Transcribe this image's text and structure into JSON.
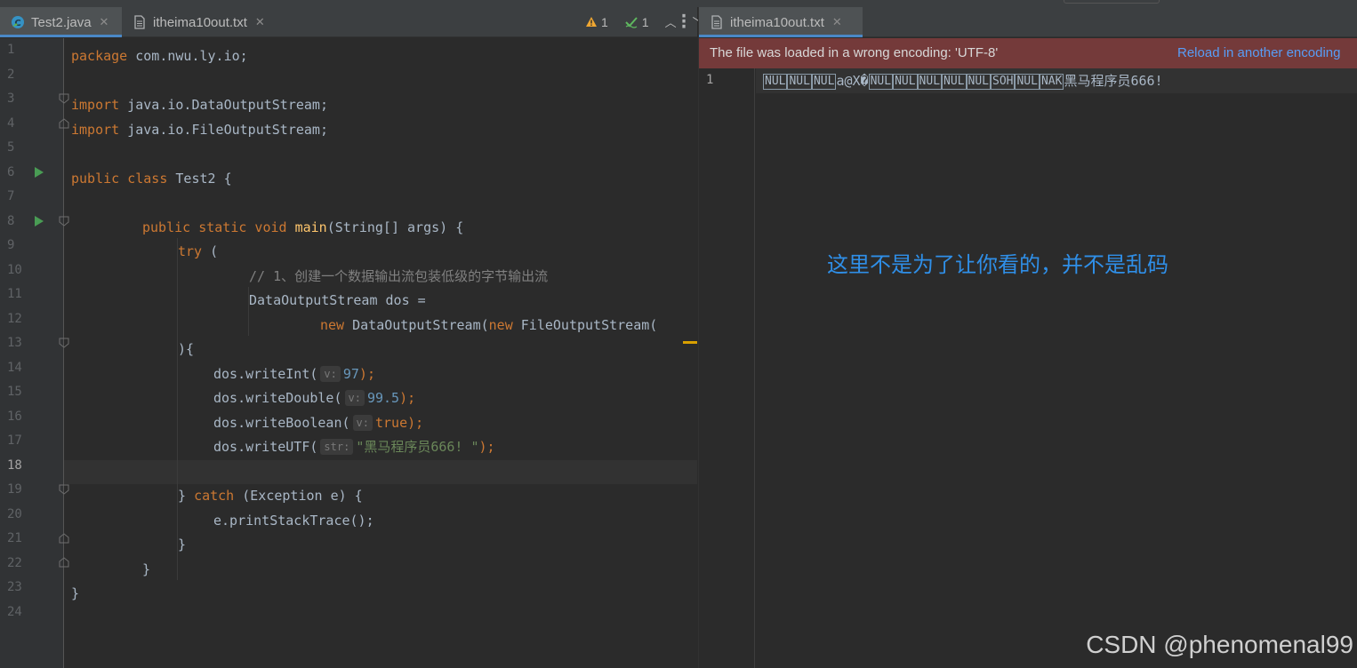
{
  "left_tabs": [
    {
      "label": "Test2.java",
      "active": true
    },
    {
      "label": "itheima10out.txt",
      "active": false
    }
  ],
  "right_tabs": [
    {
      "label": "itheima10out.txt",
      "active": true
    }
  ],
  "inspections": {
    "warnings": "1",
    "weak_warnings": "1"
  },
  "line_numbers": [
    "1",
    "2",
    "3",
    "4",
    "5",
    "6",
    "7",
    "8",
    "9",
    "10",
    "11",
    "12",
    "13",
    "14",
    "15",
    "16",
    "17",
    "18",
    "19",
    "20",
    "21",
    "22",
    "23",
    "24"
  ],
  "current_line": "18",
  "code": {
    "l1": {
      "kw": "package",
      "text": " com.nwu.ly.io;"
    },
    "l3": {
      "kw": "import",
      "text": " java.io.DataOutputStream;"
    },
    "l4": {
      "kw": "import",
      "text": " java.io.FileOutputStream;"
    },
    "l6": {
      "kw1": "public",
      "kw2": " class",
      "text": " Test2 {"
    },
    "l8": {
      "kw1": "public",
      "kw2": " static",
      "kw3": " void",
      "fn": " main",
      "text": "(String[] args) {"
    },
    "l9": {
      "kw": "try",
      "text": " ("
    },
    "l10": {
      "comment": "// 1、创建一个数据输出流包装低级的字节输出流"
    },
    "l11": {
      "text": "DataOutputStream dos ="
    },
    "l12": {
      "kw1": "new",
      "text1": " DataOutputStream(",
      "kw2": "new",
      "text2": " FileOutputStream("
    },
    "l13": {
      "text": "){"
    },
    "l14": {
      "call": "dos.writeInt(",
      "hint": "v:",
      "value": "97",
      "end": ");"
    },
    "l15": {
      "call": "dos.writeDouble(",
      "hint": "v:",
      "value": "99.5",
      "end": ");"
    },
    "l16": {
      "call": "dos.writeBoolean(",
      "hint": "v:",
      "value": "true",
      "end": ");"
    },
    "l17": {
      "call": "dos.writeUTF(",
      "hint": "str:",
      "value": "\"黑马程序员666! \"",
      "end": ");"
    },
    "l19": {
      "pre": "} ",
      "kw": "catch",
      "text": " (Exception e) {"
    },
    "l20": {
      "text": "e.printStackTrace();"
    },
    "l21": {
      "text": "}"
    },
    "l22": {
      "text": "}"
    },
    "l23": {
      "text": "}"
    }
  },
  "banner": {
    "message": "The file was loaded in a wrong encoding: 'UTF-8'",
    "action": "Reload in another encoding"
  },
  "output_file": {
    "line_number": "1",
    "ctrl_a": [
      "NUL",
      "NUL",
      "NUL"
    ],
    "mid": "a@X�",
    "ctrl_b": [
      "NUL",
      "NUL",
      "NUL",
      "NUL",
      "NUL",
      "SOH",
      "NUL",
      "NAK"
    ],
    "tail": "黑马程序员666!"
  },
  "annotation": "这里不是为了让你看的，并不是乱码",
  "watermark": "CSDN @phenomenal99",
  "colors": {
    "keyword": "#cc7832",
    "number": "#6897bb",
    "string": "#6a8759",
    "comment": "#808080",
    "banner_bg": "#743a3a",
    "link": "#589df6",
    "annotation": "#2f8fe8"
  }
}
